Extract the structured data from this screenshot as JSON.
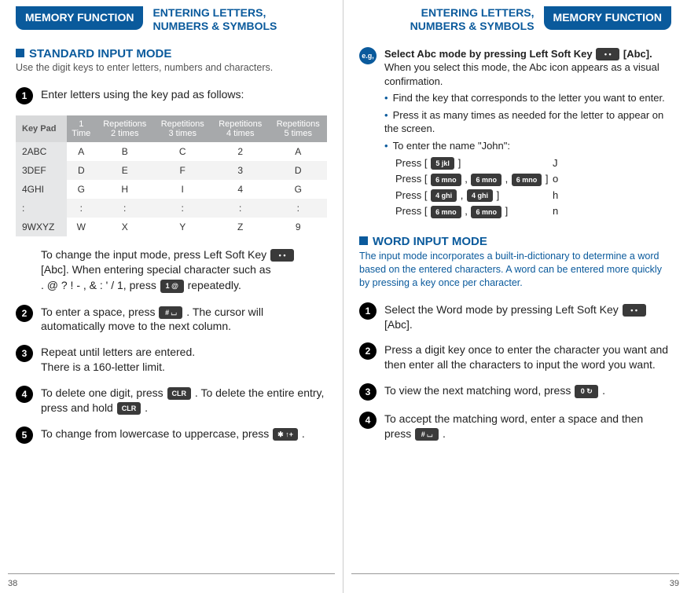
{
  "chrome": {
    "memory_function": "MEMORY FUNCTION",
    "entering": "ENTERING LETTERS,\nNUMBERS & SYMBOLS"
  },
  "page_left": "38",
  "page_right": "39",
  "left": {
    "section_title": "STANDARD INPUT MODE",
    "section_sub": "Use the digit keys to enter letters, numbers and characters.",
    "step1": "Enter letters using the key pad as follows:",
    "table": {
      "head": [
        "Key Pad",
        "1\nTime",
        "Repetitions\n2 times",
        "Repetitions\n3 times",
        "Repetitions\n4 times",
        "Repetitions\n5 times"
      ],
      "rows": [
        [
          "2ABC",
          "A",
          "B",
          "C",
          "2",
          "A"
        ],
        [
          "3DEF",
          "D",
          "E",
          "F",
          "3",
          "D"
        ],
        [
          "4GHI",
          "G",
          "H",
          "I",
          "4",
          "G"
        ],
        [
          ":",
          ":",
          ":",
          ":",
          ":",
          ":"
        ],
        [
          "9WXYZ",
          "W",
          "X",
          "Y",
          "Z",
          "9"
        ]
      ]
    },
    "note1a": "To change the input mode, press Left Soft Key ",
    "note1b": "[Abc]. When entering special character such as",
    "note1c": ". @ ? ! - , & : ' / 1, press ",
    "note1d": " repeatedly.",
    "step2a": "To enter a space, press ",
    "step2b": " . The cursor will automatically move to the next column.",
    "step3": "Repeat until letters are entered.\nThere is a 160-letter limit.",
    "step4a": "To delete one digit, press ",
    "step4b": " . To delete the entire entry, press and hold ",
    "step4c": " .",
    "step5a": "To change from lowercase to uppercase, press ",
    "step5b": " .",
    "keys": {
      "softkey": "• •",
      "one": "1  @",
      "pound": "# ⌴",
      "clr": "CLR",
      "star": "✱ ↑+"
    }
  },
  "right": {
    "eg": "e.g,",
    "sel_a": "Select Abc mode by pressing Left Soft Key ",
    "sel_b": " [Abc].",
    "sel_sub": "When you select this mode, the Abc icon appears as a visual confirmation.",
    "b1": "Find the key that corresponds to the letter you want to enter.",
    "b2": "Press it as many times as needed for the letter to appear on the screen.",
    "b3": "To enter the name \"John\":",
    "john": [
      {
        "label": "Press [",
        "keys": [
          "5 jkl"
        ],
        "close": " ]",
        "out": "J"
      },
      {
        "label": "Press [",
        "keys": [
          "6 mno",
          "6 mno",
          "6 mno"
        ],
        "close": " ]",
        "out": "o"
      },
      {
        "label": "Press [",
        "keys": [
          "4 ghi",
          "4 ghi"
        ],
        "close": " ]",
        "out": "h"
      },
      {
        "label": "Press [",
        "keys": [
          "6 mno",
          "6 mno"
        ],
        "close": " ]",
        "out": "n"
      }
    ],
    "section_title": "WORD INPUT MODE",
    "section_desc": "The input mode incorporates a built-in-dictionary to determine a word based on the entered characters. A word can be entered more quickly by pressing a key once per character.",
    "s1a": "Select the Word mode by pressing Left Soft Key ",
    "s1b": "[Abc].",
    "s2": "Press a digit key once to enter the character you want and then enter all the characters to input the word you want.",
    "s3a": "To view the next matching word, press ",
    "s3b": " .",
    "s4a": "To accept the matching word, enter a space and then press ",
    "s4b": " .",
    "keys": {
      "softkey": "• •",
      "zero": "0  ↻",
      "pound": "# ⌴"
    }
  }
}
